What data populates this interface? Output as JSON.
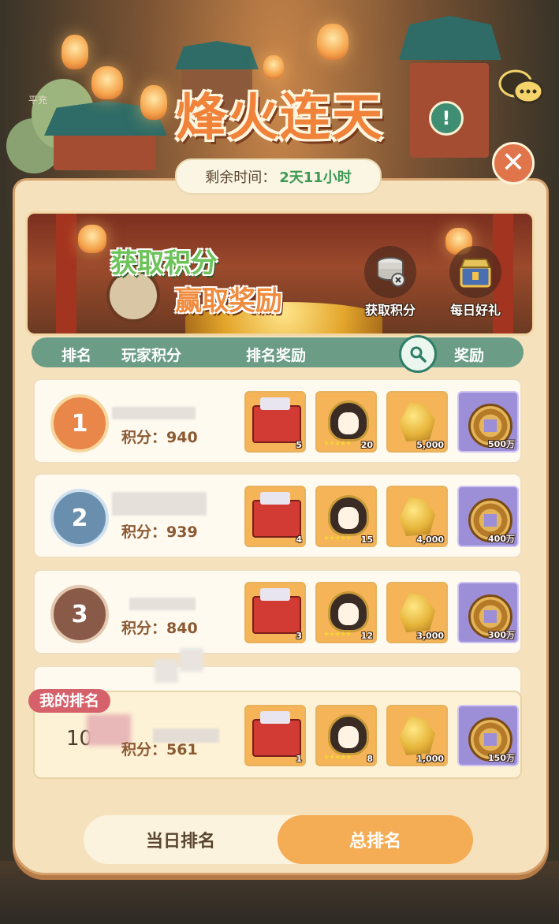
{
  "title": "烽火连天",
  "timer": {
    "label": "剩余时间：",
    "value": "2天11小时"
  },
  "side_label": "平充",
  "banner": {
    "slogan_line1": "获取积分",
    "slogan_line2": "赢取奖励",
    "buttons": [
      {
        "label": "获取积分",
        "icon": "coin-stack-icon"
      },
      {
        "label": "每日好礼",
        "icon": "gift-chest-icon"
      }
    ]
  },
  "table_header": {
    "rank": "排名",
    "player_score": "玩家积分",
    "rank_reward": "排名奖励",
    "reward": "奖励"
  },
  "rows": [
    {
      "rank": "1",
      "score": "积分：940",
      "rewards": [
        "5",
        "20",
        "5,000",
        "500万"
      ]
    },
    {
      "rank": "2",
      "score": "积分：939",
      "rewards": [
        "4",
        "15",
        "4,000",
        "400万"
      ]
    },
    {
      "rank": "3",
      "score": "积分：840",
      "rewards": [
        "3",
        "12",
        "3,000",
        "300万"
      ]
    }
  ],
  "my_rank": {
    "tag": "我的排名",
    "rank": "10",
    "score": "积分：561",
    "rewards": [
      "1",
      "8",
      "1,000",
      "150万"
    ]
  },
  "tabs": {
    "daily": "当日排名",
    "total": "总排名"
  },
  "colors": {
    "accent": "#f5ad55",
    "header": "#6a9c86",
    "panel": "#f6e1bd",
    "title": "#f0823a"
  }
}
